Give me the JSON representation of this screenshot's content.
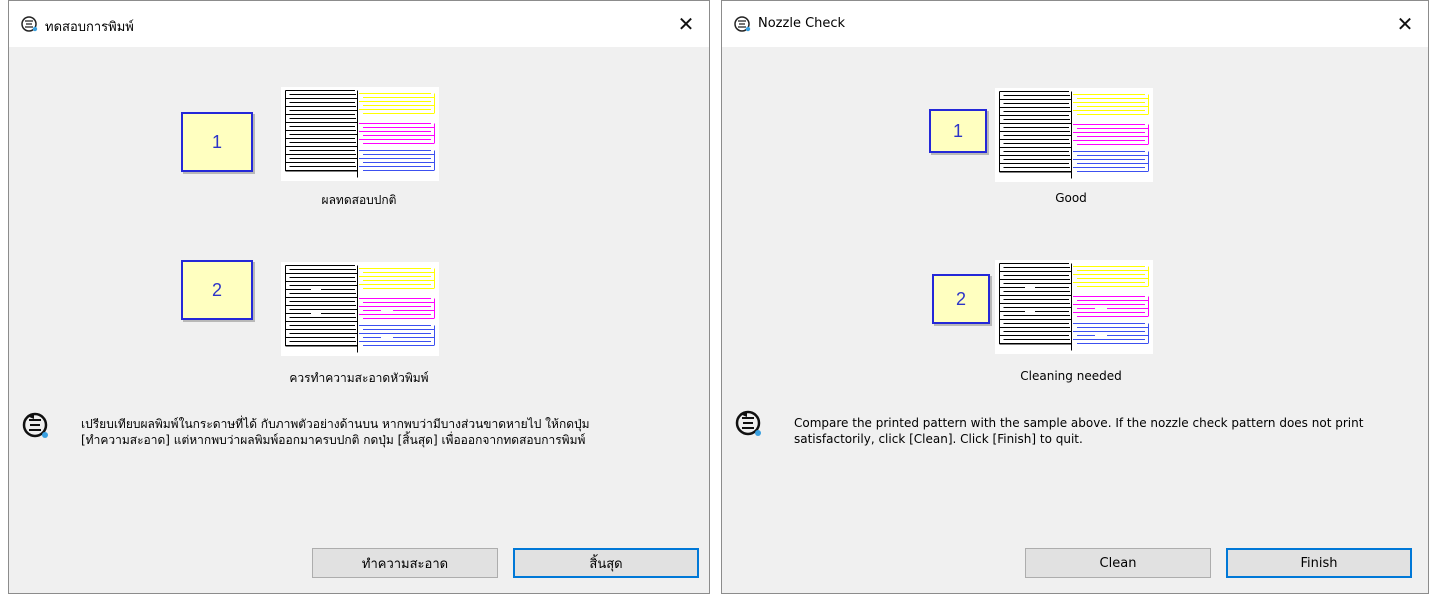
{
  "dialogs": {
    "thai": {
      "title": "ทดสอบการพิมพ์",
      "sample1_number": "1",
      "sample1_caption": "ผลทดสอบปกติ",
      "sample2_number": "2",
      "sample2_caption": "ควรทำความสะอาดหัวพิมพ์",
      "info_line1": "เปรียบเทียบผลพิมพ์ในกระดาษที่ได้ กับภาพตัวอย่างด้านบน หากพบว่ามีบางส่วนขาดหายไป ให้กดปุ่ม",
      "info_line2": "[ทำความสะอาด] แต่หากพบว่าผลพิมพ์ออกมาครบปกติ กดปุ่ม [สิ้นสุด] เพื่อออกจากทดสอบการพิมพ์",
      "clean_label": "ทำความสะอาด",
      "finish_label": "สิ้นสุด"
    },
    "english": {
      "title": "Nozzle Check",
      "sample1_number": "1",
      "sample1_caption": "Good",
      "sample2_number": "2",
      "sample2_caption": "Cleaning needed",
      "info_line1": "Compare the printed pattern with the sample above. If the nozzle check pattern does not print",
      "info_line2": "satisfactorily, click [Clean]. Click [Finish] to quit.",
      "clean_label": "Clean",
      "finish_label": "Finish"
    }
  },
  "icons": {
    "title": "printer-utility-icon",
    "close": "close-icon",
    "info": "printer-guide-icon"
  },
  "colors": {
    "accent": "#0078d7",
    "number_border": "#2428d8",
    "number_fill": "#ffffc0",
    "pattern_black": "#000000",
    "pattern_yellow": "#ffff00",
    "pattern_magenta": "#ff00ff",
    "pattern_blue": "#3c50f0"
  }
}
